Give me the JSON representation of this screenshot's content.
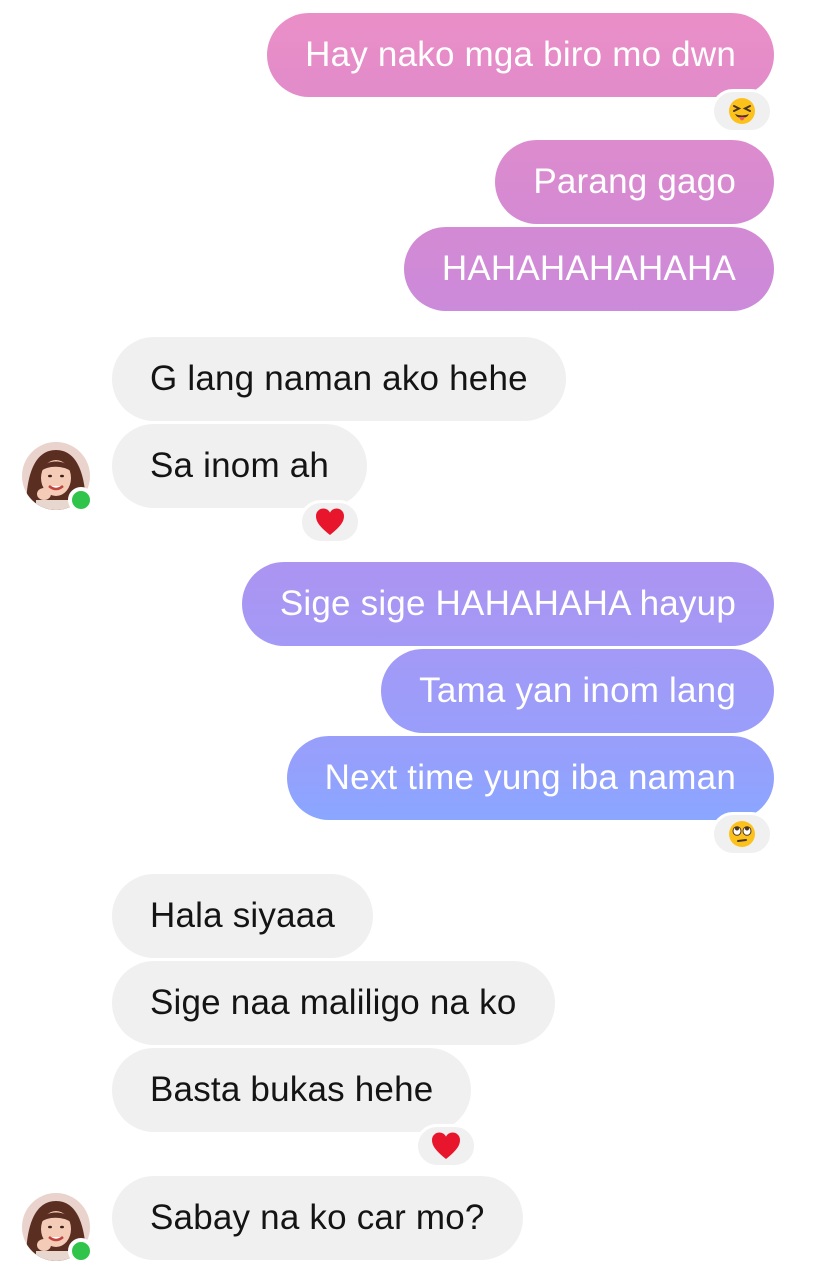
{
  "messages": [
    {
      "side": "out",
      "text": "Hay nako mga biro mo dwn"
    },
    {
      "side": "out",
      "text": "Parang gago"
    },
    {
      "side": "out",
      "text": "HAHAHAHAHAHA"
    },
    {
      "side": "in",
      "text": "G lang naman ako hehe"
    },
    {
      "side": "in",
      "text": "Sa inom ah"
    },
    {
      "side": "out",
      "text": "Sige sige HAHAHAHA hayup"
    },
    {
      "side": "out",
      "text": "Tama yan inom lang"
    },
    {
      "side": "out",
      "text": "Next time yung iba naman"
    },
    {
      "side": "in",
      "text": "Hala siyaaa"
    },
    {
      "side": "in",
      "text": "Sige naa maliligo na ko"
    },
    {
      "side": "in",
      "text": "Basta bukas hehe"
    },
    {
      "side": "in",
      "text": "Sabay na ko car mo?"
    }
  ],
  "reactions": [
    {
      "on_message": 0,
      "icon": "squinting-tongue-emoji"
    },
    {
      "on_message": 4,
      "icon": "red-heart-emoji"
    },
    {
      "on_message": 7,
      "icon": "eye-roll-emoji"
    },
    {
      "on_message": 10,
      "icon": "red-heart-emoji"
    }
  ],
  "colors": {
    "outgoing_gradient": [
      "#ec8fc6",
      "#cc8ad9",
      "#ad94f1",
      "#8aa6ff"
    ],
    "incoming_bubble": "#f0f0f0",
    "online_status": "#31c44a",
    "heart": "#e8162c"
  },
  "contact": {
    "online": true
  }
}
